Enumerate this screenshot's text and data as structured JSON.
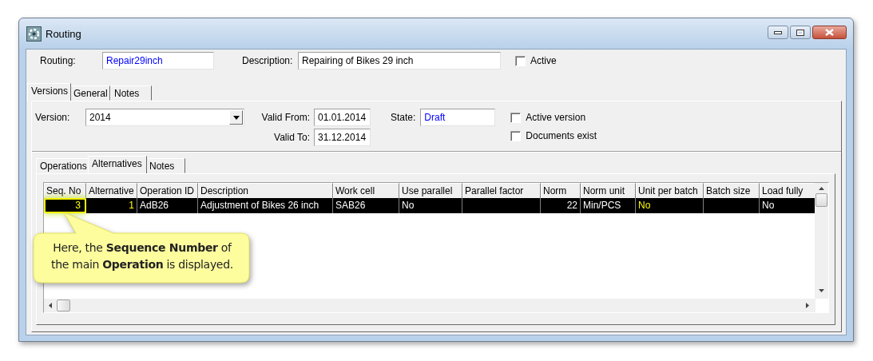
{
  "window": {
    "title": "Routing"
  },
  "routing": {
    "label": "Routing:",
    "value": "Repair29inch"
  },
  "description": {
    "label": "Description:",
    "value": "Repairing of Bikes 29 inch"
  },
  "active": {
    "label": "Active",
    "checked": false
  },
  "tabs": [
    {
      "label": "Versions",
      "selected": true
    },
    {
      "label": "General",
      "selected": false
    },
    {
      "label": "Notes",
      "selected": false
    }
  ],
  "version": {
    "label": "Version:",
    "value": "2014"
  },
  "valid_from": {
    "label": "Valid From:",
    "value": "01.01.2014"
  },
  "valid_to": {
    "label": "Valid To:",
    "value": "31.12.2014"
  },
  "state": {
    "label": "State:",
    "value": "Draft"
  },
  "active_version": {
    "label": "Active version",
    "checked": false
  },
  "documents_exist": {
    "label": "Documents exist",
    "checked": false
  },
  "sub_tabs": [
    {
      "label": "Operations",
      "selected": false
    },
    {
      "label": "Alternatives",
      "selected": true
    },
    {
      "label": "Notes",
      "selected": false
    }
  ],
  "table": {
    "columns": [
      "Seq. No",
      "Alternative",
      "Operation ID",
      "Description",
      "Work cell",
      "Use parallel",
      "Parallel factor",
      "Norm",
      "Norm unit",
      "Unit per batch",
      "Batch size",
      "Load fully"
    ],
    "rows": [
      {
        "selected": true,
        "cells": [
          {
            "text": "3",
            "color": "#ffff00",
            "highlighted": true
          },
          {
            "text": "1",
            "color": "#ffff00",
            "highlighted": false
          },
          {
            "text": "AdB26",
            "color": "#ffffff",
            "highlighted": false
          },
          {
            "text": "Adjustment of Bikes 26 inch",
            "color": "#ffffff",
            "highlighted": false
          },
          {
            "text": "SAB26",
            "color": "#ffffff",
            "highlighted": false
          },
          {
            "text": "No",
            "color": "#ffffff",
            "highlighted": false
          },
          {
            "text": "",
            "highlighted": false
          },
          {
            "text": "22",
            "color": "#ffffff",
            "highlighted": false
          },
          {
            "text": "Min/PCS",
            "color": "#ffffff",
            "highlighted": false
          },
          {
            "text": "No",
            "color": "#ffff00",
            "highlighted": false
          },
          {
            "text": "",
            "highlighted": false
          },
          {
            "text": "No",
            "color": "#ffffff",
            "highlighted": false
          }
        ]
      }
    ]
  },
  "callout": {
    "text": "Here, the **Sequence Number** of the main **Operation** is displayed."
  }
}
